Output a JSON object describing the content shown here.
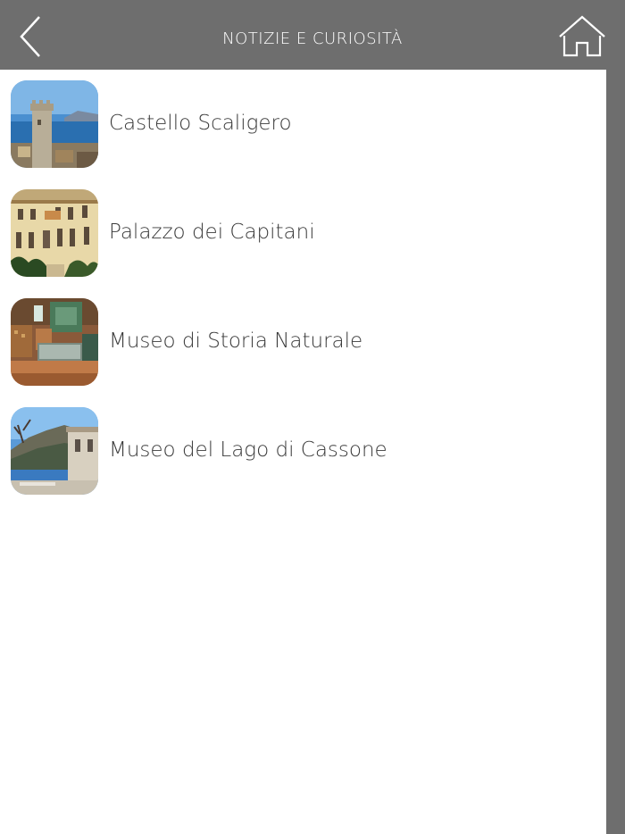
{
  "header": {
    "title": "NOTIZIE E CURIOSITÀ",
    "back_icon": "chevron-left-icon",
    "home_icon": "home-icon",
    "background": "#6e6e6e",
    "text_color": "#ffffff"
  },
  "list": {
    "items": [
      {
        "label": "Castello Scaligero",
        "thumbnail": "castle-tower-photo"
      },
      {
        "label": "Palazzo dei Capitani",
        "thumbnail": "palace-facade-photo"
      },
      {
        "label": "Museo di Storia Naturale",
        "thumbnail": "museum-interior-photo"
      },
      {
        "label": "Museo del Lago di Cassone",
        "thumbnail": "lake-shore-photo"
      }
    ]
  }
}
